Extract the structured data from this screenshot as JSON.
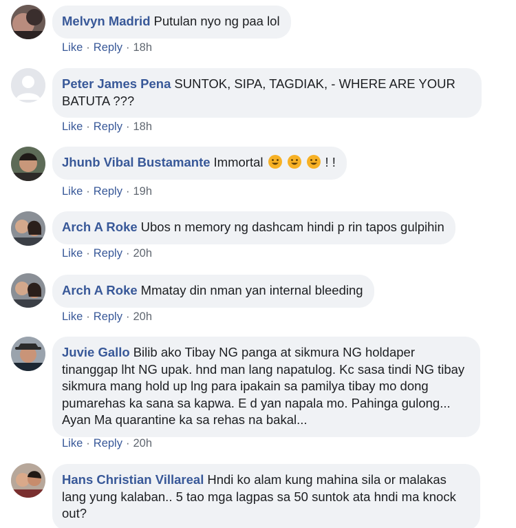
{
  "comments": [
    {
      "author": "Melvyn Madrid",
      "text": "Putulan nyo ng paa lol",
      "actions": {
        "like": "Like",
        "reply": "Reply",
        "time": "18h"
      },
      "avatar_icon": "profile-photo"
    },
    {
      "author": "Peter James Pena",
      "text": "SUNTOK, SIPA, TAGDIAK, - WHERE ARE YOUR BATUTA ???",
      "actions": {
        "like": "Like",
        "reply": "Reply",
        "time": "18h"
      },
      "avatar_icon": "default-profile-silhouette"
    },
    {
      "author": "Jhunb Vibal Bustamante",
      "text": "Immortal",
      "suffix": "! !",
      "emojis": [
        "smiley-emoji",
        "smiley-emoji",
        "smiley-emoji"
      ],
      "actions": {
        "like": "Like",
        "reply": "Reply",
        "time": "19h"
      },
      "avatar_icon": "profile-photo"
    },
    {
      "author": "Arch A Roke",
      "text": "Ubos n memory ng dashcam hindi p rin tapos gulpihin",
      "actions": {
        "like": "Like",
        "reply": "Reply",
        "time": "20h"
      },
      "avatar_icon": "profile-photo"
    },
    {
      "author": "Arch A Roke",
      "text": "Mmatay din nman yan internal bleeding",
      "actions": {
        "like": "Like",
        "reply": "Reply",
        "time": "20h"
      },
      "avatar_icon": "profile-photo"
    },
    {
      "author": "Juvie Gallo",
      "text": "Bilib ako Tibay NG panga at sikmura NG holdaper tinanggap lht NG upak. hnd man lang napatulog. Kc sasa tindi NG tibay sikmura mang hold up lng para ipakain sa pamilya tibay mo dong pumarehas ka sana sa kapwa. E d yan napala mo. Pahinga gulong... Ayan Ma quarantine ka sa rehas na bakal...",
      "actions": {
        "like": "Like",
        "reply": "Reply",
        "time": "20h"
      },
      "avatar_icon": "profile-photo"
    },
    {
      "author": "Hans Christian Villareal",
      "text": "Hndi ko alam kung mahina sila or malakas lang yung kalaban.. 5 tao mga lagpas sa 50 suntok ata hndi ma knock out?",
      "avatar_icon": "profile-photo"
    }
  ],
  "colors": {
    "author": "#385898",
    "bubble": "#f0f2f5",
    "meta": "#606770",
    "emoji": "#f7b125"
  }
}
